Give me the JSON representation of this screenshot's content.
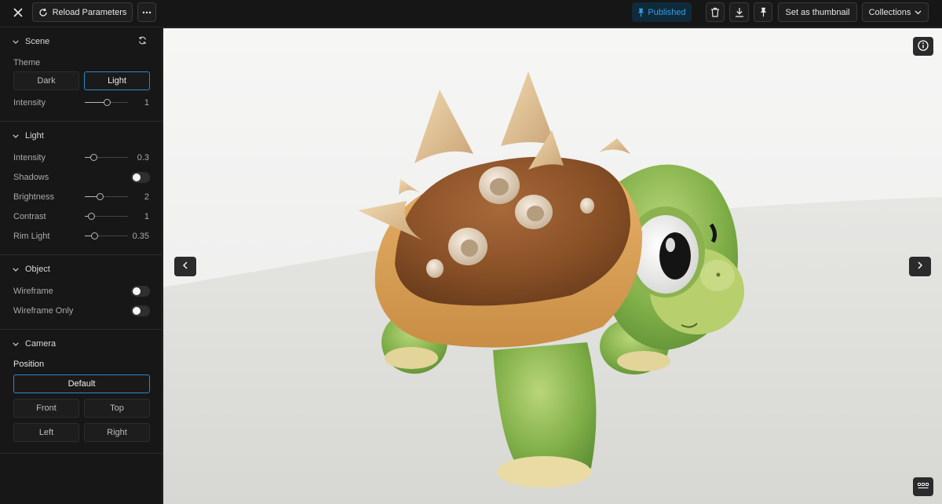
{
  "toolbar": {
    "reload_label": "Reload Parameters",
    "published_label": "Published",
    "thumbnail_label": "Set as thumbnail",
    "collections_label": "Collections"
  },
  "icons": {
    "close": "close-icon",
    "reload": "refresh-icon",
    "more": "more-horizontal-icon",
    "pin": "pin-icon",
    "trash": "trash-icon",
    "download": "download-icon",
    "chevron_down": "chevron-down-icon",
    "info": "info-icon",
    "grid": "grid-icon",
    "prev": "chevron-left-icon",
    "next": "chevron-right-icon"
  },
  "colors": {
    "accent": "#2e89c8",
    "published_text": "#3a9be0",
    "published_bg": "#0f2a3a"
  },
  "sidebar": {
    "scene": {
      "title": "Scene",
      "theme_label": "Theme",
      "theme_options": [
        "Dark",
        "Light"
      ],
      "theme_selected": "Light",
      "intensity": {
        "label": "Intensity",
        "value": "1",
        "fraction": 0.5
      }
    },
    "light": {
      "title": "Light",
      "intensity": {
        "label": "Intensity",
        "value": "0.3",
        "fraction": 0.2
      },
      "shadows": {
        "label": "Shadows",
        "on": false
      },
      "brightness": {
        "label": "Brightness",
        "value": "2",
        "fraction": 0.35
      },
      "contrast": {
        "label": "Contrast",
        "value": "1",
        "fraction": 0.15
      },
      "rim_light": {
        "label": "Rim Light",
        "value": "0.35",
        "fraction": 0.22
      }
    },
    "object": {
      "title": "Object",
      "wireframe": {
        "label": "Wireframe",
        "on": false
      },
      "wireframe_only": {
        "label": "Wireframe Only",
        "on": false
      }
    },
    "camera": {
      "title": "Camera",
      "position_label": "Position",
      "default_label": "Default",
      "front_label": "Front",
      "top_label": "Top",
      "left_label": "Left",
      "right_label": "Right"
    }
  }
}
